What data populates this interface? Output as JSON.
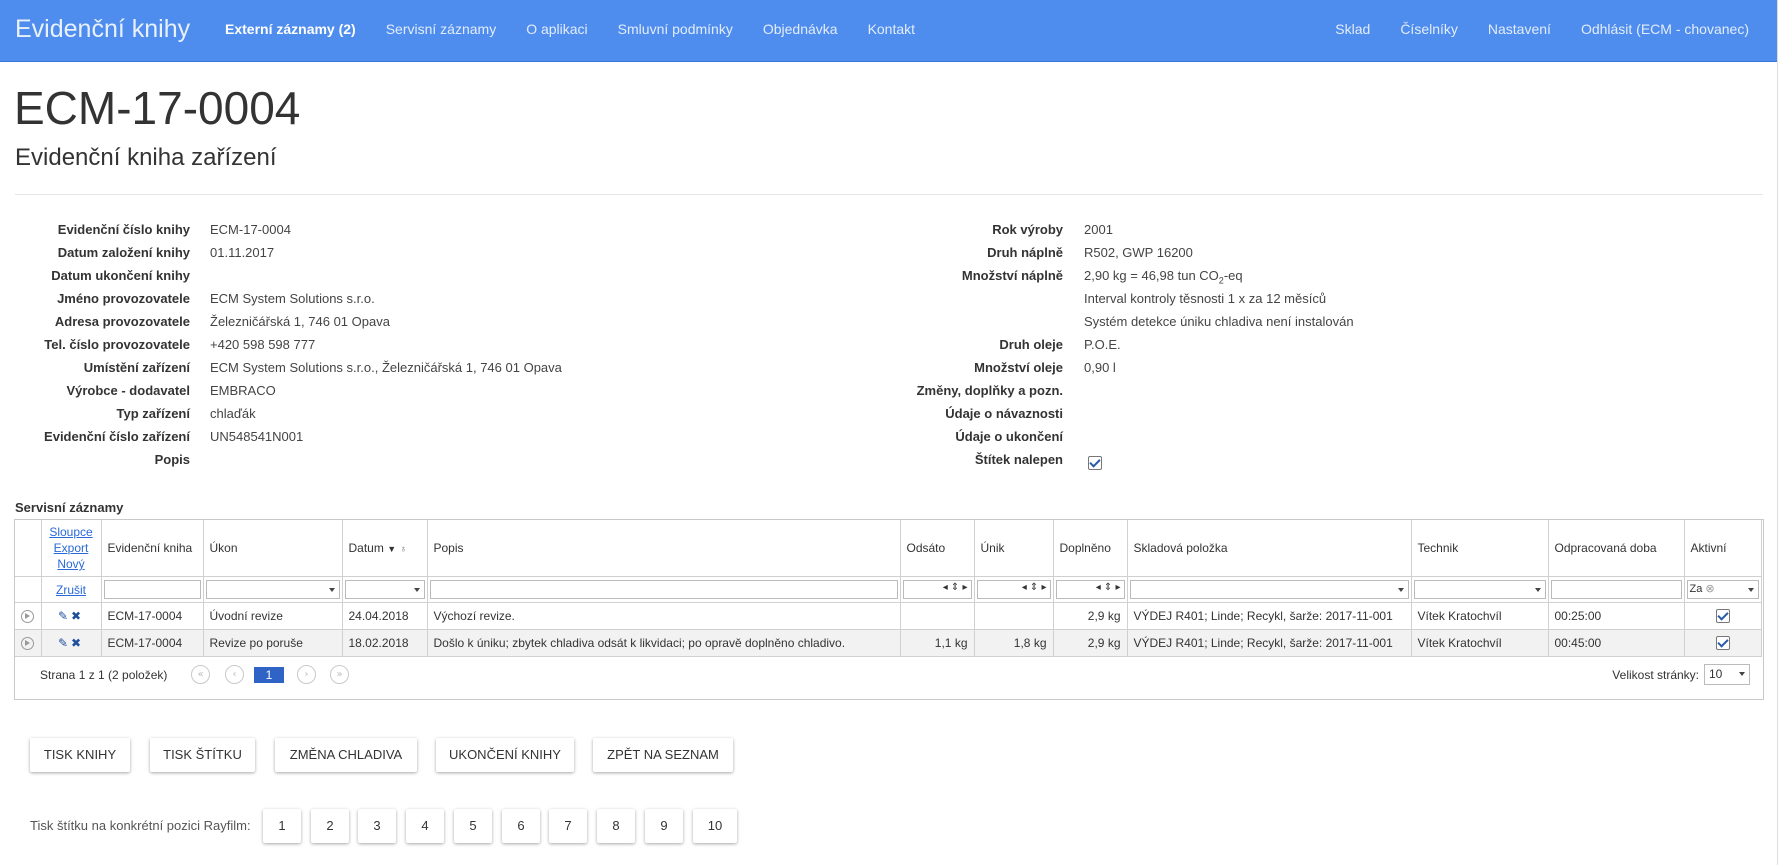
{
  "app": {
    "brand": "Evidenční knihy"
  },
  "nav": {
    "left": [
      "Externí záznamy (2)",
      "Servisní záznamy",
      "O aplikaci",
      "Smluvní podmínky",
      "Objednávka",
      "Kontakt"
    ],
    "right": [
      "Sklad",
      "Číselníky",
      "Nastavení",
      "Odhlásit (ECM - chovanec)"
    ]
  },
  "page": {
    "title": "ECM-17-0004",
    "subtitle": "Evidenční kniha zařízení"
  },
  "details_left": [
    {
      "label": "Evidenční číslo knihy",
      "value": "ECM-17-0004"
    },
    {
      "label": "Datum založení knihy",
      "value": "01.11.2017"
    },
    {
      "label": "Datum ukončení knihy",
      "value": ""
    },
    {
      "label": "Jméno provozovatele",
      "value": "ECM System Solutions s.r.o."
    },
    {
      "label": "Adresa provozovatele",
      "value": "Železničářská 1, 746 01 Opava"
    },
    {
      "label": "Tel. číslo provozovatele",
      "value": "+420 598 598 777"
    },
    {
      "label": "Umístění zařízení",
      "value": "ECM System Solutions s.r.o., Železničářská 1, 746 01 Opava"
    },
    {
      "label": "Výrobce - dodavatel",
      "value": "EMBRACO"
    },
    {
      "label": "Typ zařízení",
      "value": "chlaďák"
    },
    {
      "label": "Evidenční číslo zařízení",
      "value": "UN548541N001"
    },
    {
      "label": "Popis",
      "value": ""
    }
  ],
  "details_right": [
    {
      "label": "Rok výroby",
      "value": "2001"
    },
    {
      "label": "Druh náplně",
      "value": "R502, GWP 16200"
    },
    {
      "label": "Množství náplně",
      "value": "2,90 kg = 46,98 tun CO",
      "sub": "2",
      "suffix": "-eq"
    },
    {
      "label": "",
      "value": "Interval kontroly těsnosti 1 x za 12 měsíců"
    },
    {
      "label": "",
      "value": "Systém detekce úniku chladiva není instalován"
    },
    {
      "label": "Druh oleje",
      "value": "P.O.E."
    },
    {
      "label": "Množství oleje",
      "value": "0,90 l"
    },
    {
      "label": "Změny, doplňky a pozn.",
      "value": ""
    },
    {
      "label": "Údaje o návaznosti",
      "value": ""
    },
    {
      "label": "Údaje o ukončení",
      "value": ""
    },
    {
      "label": "Štítek nalepen",
      "value": "",
      "checkbox": true
    }
  ],
  "service": {
    "title": "Servisní záznamy",
    "cmd_links": [
      "Sloupce",
      "Export",
      "Nový"
    ],
    "cancel_filter": "Zrušit",
    "columns": [
      "Evidenční kniha",
      "Úkon",
      "Datum",
      "Popis",
      "Odsáto",
      "Únik",
      "Doplněno",
      "Skladová položka",
      "Technik",
      "Odpracovaná doba",
      "Aktivní"
    ],
    "active_filter": "Za",
    "rows": [
      {
        "book": "ECM-17-0004",
        "action": "Úvodní revize",
        "date": "24.04.2018",
        "desc": "Výchozí revize.",
        "odsato": "",
        "unik": "",
        "doplneno": "2,9 kg",
        "stock": "VÝDEJ R401; Linde; Recykl, šarže: 2017-11-001",
        "tech": "Vítek Kratochvíl",
        "time": "00:25:00",
        "active": true
      },
      {
        "book": "ECM-17-0004",
        "action": "Revize po poruše",
        "date": "18.02.2018",
        "desc": "Došlo k úniku; zbytek chladiva odsát k likvidaci; po opravě doplněno chladivo.",
        "odsato": "1,1 kg",
        "unik": "1,8 kg",
        "doplneno": "2,9 kg",
        "stock": "VÝDEJ R401; Linde; Recykl, šarže: 2017-11-001",
        "tech": "Vítek Kratochvíl",
        "time": "00:45:00",
        "active": true
      }
    ],
    "pager": {
      "info": "Strana 1 z 1 (2 položek)",
      "current": "1",
      "size_label": "Velikost stránky:",
      "size": "10"
    }
  },
  "buttons": [
    "TISK KNIHY",
    "TISK ŠTÍTKU",
    "ZMĚNA CHLADIVA",
    "UKONČENÍ KNIHY",
    "ZPĚT NA SEZNAM"
  ],
  "rayfilm": {
    "label": "Tisk štítku na konkrétní pozici Rayfilm:",
    "positions": [
      "1",
      "2",
      "3",
      "4",
      "5",
      "6",
      "7",
      "8",
      "9",
      "10"
    ]
  },
  "colors": {
    "topbar": "#4e8ded",
    "link": "#2a6ad8",
    "pager_current": "#3063c6"
  }
}
